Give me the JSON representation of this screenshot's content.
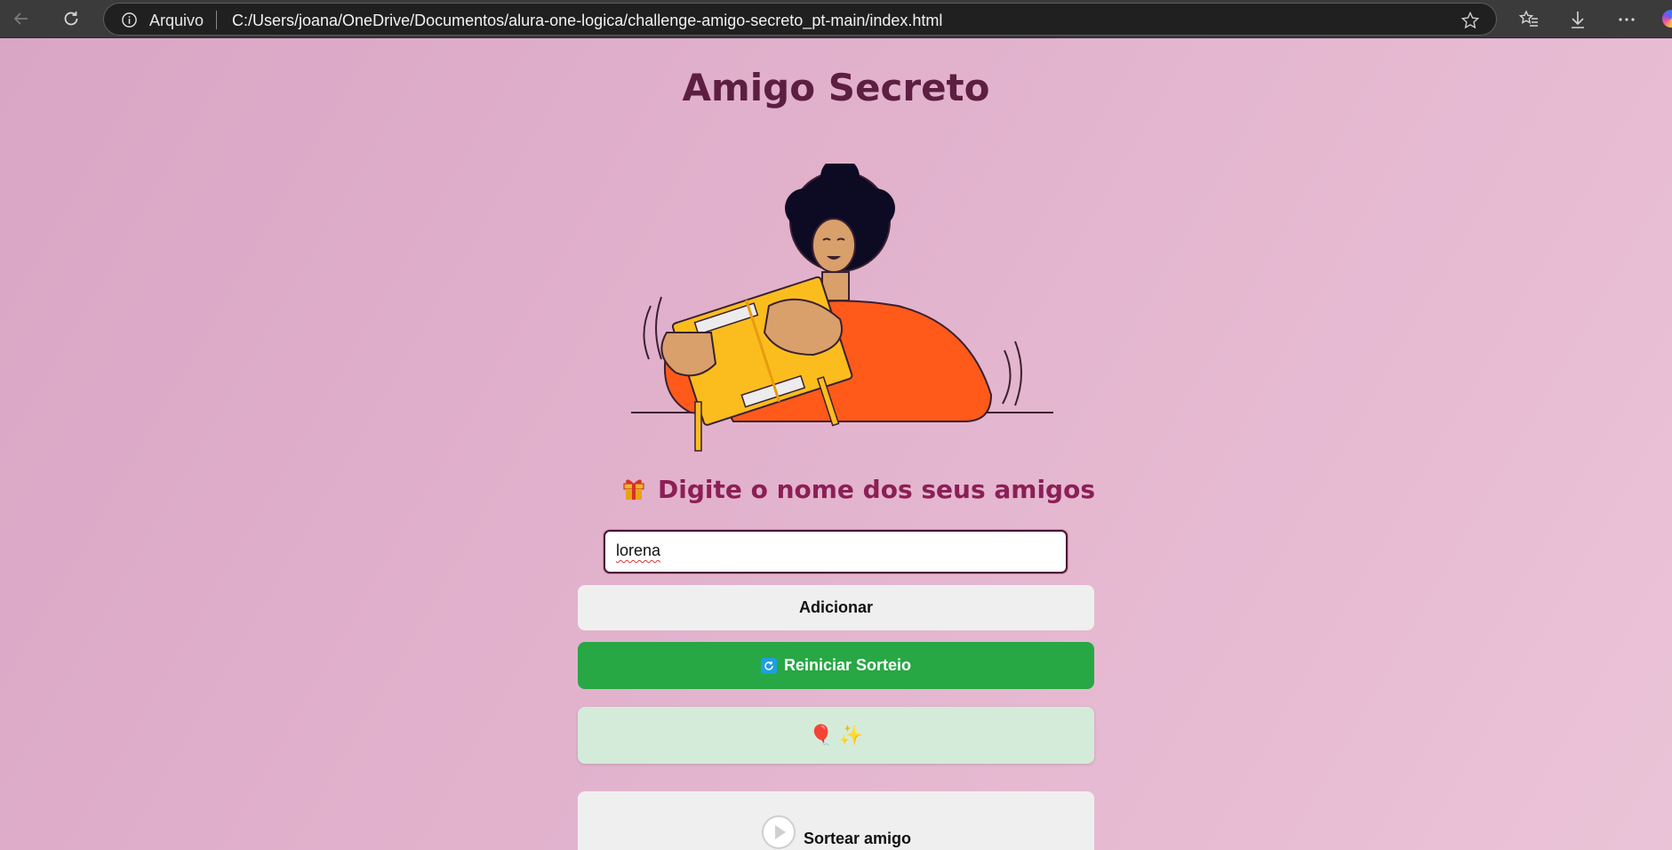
{
  "browser": {
    "origin_label": "Arquivo",
    "url": "C:/Users/joana/OneDrive/Documentos/alura-one-logica/challenge-amigo-secreto_pt-main/index.html"
  },
  "page": {
    "title": "Amigo Secreto",
    "subtitle": "Digite o nome dos seus amigos",
    "input_value": "lorena",
    "add_button": "Adicionar",
    "reset_button": "Reiniciar Sorteio",
    "result_text": "🎈 ✨",
    "draw_button": "Sortear amigo"
  },
  "colors": {
    "title": "#5c1e41",
    "subtitle": "#8c1f56",
    "reset_button": "#28a745",
    "result_box": "#d4ebd9",
    "input_border": "#4a1633"
  },
  "icons": [
    "back-icon",
    "refresh-icon",
    "info-icon",
    "star-icon",
    "favorites-icon",
    "download-icon",
    "more-icon",
    "gift-icon",
    "reset-icon",
    "play-icon"
  ]
}
